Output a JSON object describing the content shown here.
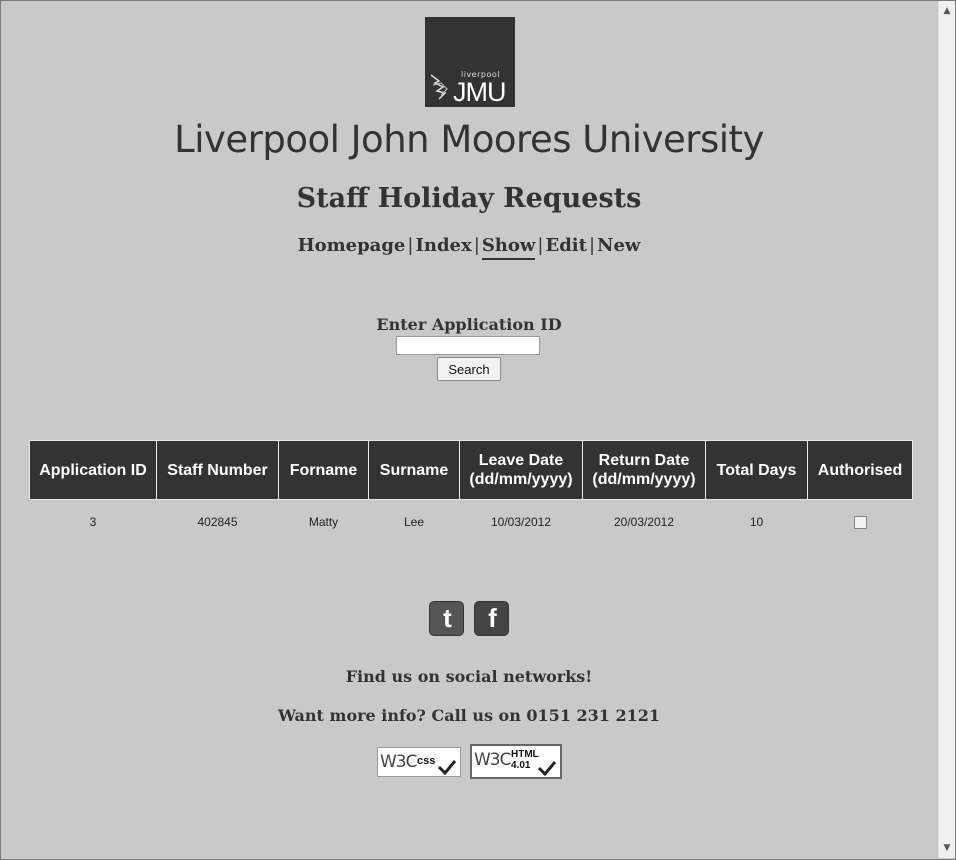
{
  "logo": {
    "small_text": "liverpool",
    "big_text": "JMU"
  },
  "university_name": "Liverpool John Moores University",
  "page_title": "Staff Holiday Requests",
  "nav": {
    "homepage": "Homepage",
    "index": "Index",
    "show": "Show",
    "edit": "Edit",
    "new": "New",
    "separator": "|",
    "active": "Show"
  },
  "search": {
    "label": "Enter Application ID",
    "value": "",
    "placeholder": "",
    "button_label": "Search"
  },
  "table": {
    "headers": [
      "Application ID",
      "Staff Number",
      "Forname",
      "Surname",
      "Leave Date (dd/mm/yyyy)",
      "Return Date (dd/mm/yyyy)",
      "Total Days",
      "Authorised"
    ],
    "header_lines": {
      "leave": [
        "Leave Date",
        "(dd/mm/yyyy)"
      ],
      "return": [
        "Return Date",
        "(dd/mm/yyyy)"
      ]
    },
    "rows": [
      {
        "application_id": "3",
        "staff_number": "402845",
        "forname": "Matty",
        "surname": "Lee",
        "leave_date": "10/03/2012",
        "return_date": "20/03/2012",
        "total_days": "10",
        "authorised": false
      }
    ]
  },
  "social": {
    "twitter_icon": "twitter-icon",
    "facebook_icon": "facebook-icon",
    "twitter_glyph": "t",
    "facebook_glyph": "f"
  },
  "footer": {
    "find_text": "Find us on social networks!",
    "info_text": "Want more info? Call us on 0151 231 2121"
  },
  "badges": {
    "w3c": "W3C",
    "css_label": "css",
    "html_label_1": "HTML",
    "html_label_2": "4.01"
  },
  "colors": {
    "background": "#c9c9c9",
    "header_bg": "#333333",
    "text": "#333333"
  }
}
